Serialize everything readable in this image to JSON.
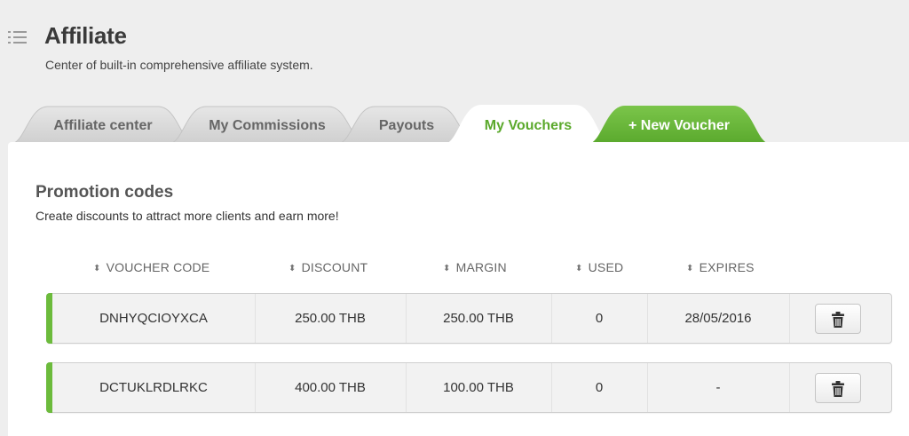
{
  "header": {
    "menu_icon": "list-icon",
    "title": "Affiliate",
    "subtitle": "Center of built-in comprehensive affiliate system."
  },
  "tabs": [
    {
      "label": "Affiliate center",
      "state": "inactive"
    },
    {
      "label": "My Commissions",
      "state": "inactive"
    },
    {
      "label": "Payouts",
      "state": "inactive"
    },
    {
      "label": "My Vouchers",
      "state": "active"
    },
    {
      "label": "+ New Voucher",
      "state": "action",
      "icon": "plus-icon"
    }
  ],
  "section": {
    "title": "Promotion codes",
    "subtitle": "Create discounts to attract more clients and earn more!"
  },
  "table": {
    "sort_icon": "sort-icon",
    "columns": [
      "VOUCHER CODE",
      "DISCOUNT",
      "MARGIN",
      "USED",
      "EXPIRES"
    ],
    "rows": [
      {
        "code": "DNHYQCIOYXCA",
        "discount": "250.00 THB",
        "margin": "250.00 THB",
        "used": "0",
        "expires": "28/05/2016",
        "action_icon": "trash-icon"
      },
      {
        "code": "DCTUKLRDLRKC",
        "discount": "400.00 THB",
        "margin": "100.00 THB",
        "used": "0",
        "expires": "-",
        "action_icon": "trash-icon"
      }
    ]
  },
  "colors": {
    "accent_green": "#6cbb3c",
    "active_tab_text": "#5ba92c",
    "background": "#eeeeee"
  }
}
